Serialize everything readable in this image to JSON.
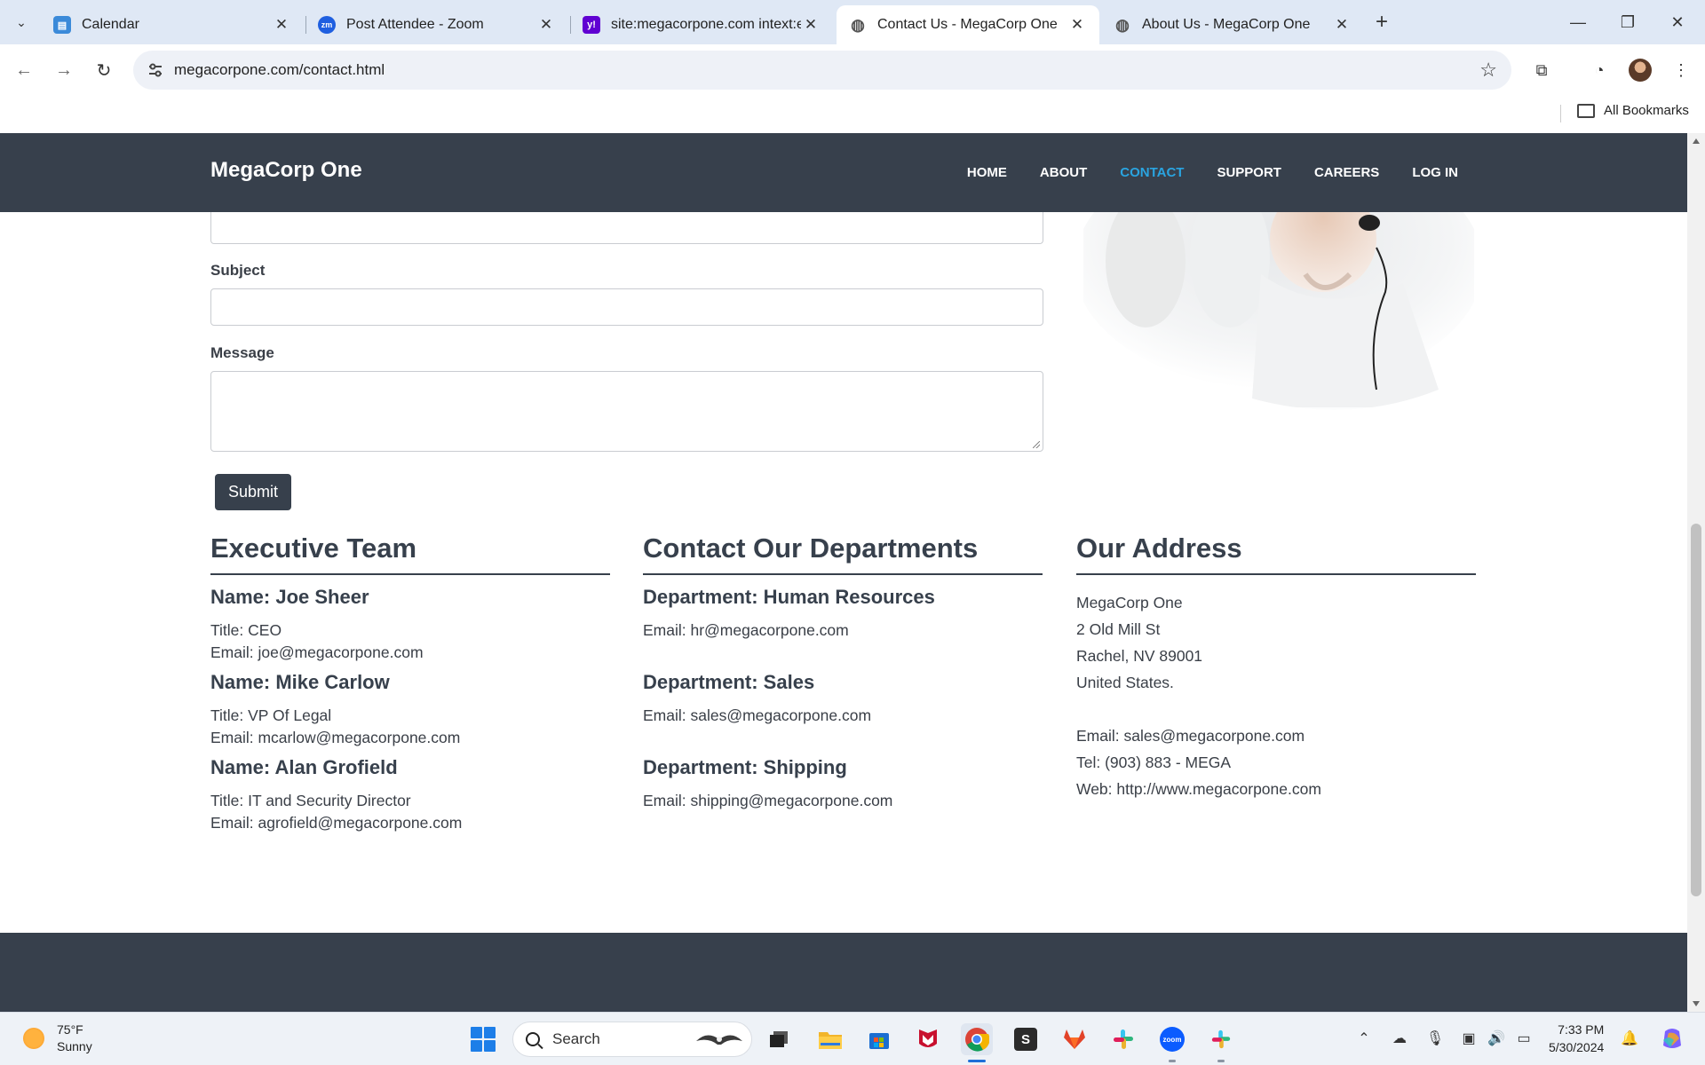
{
  "browser": {
    "tabs": [
      {
        "title": "Calendar",
        "icon": "calendar-favicon",
        "active": false
      },
      {
        "title": "Post Attendee - Zoom",
        "icon": "zoom-favicon",
        "active": false
      },
      {
        "title": "site:megacorpone.com intext:em",
        "icon": "yahoo-favicon",
        "active": false
      },
      {
        "title": "Contact Us - MegaCorp One",
        "icon": "globe-favicon",
        "active": true
      },
      {
        "title": "About Us - MegaCorp One",
        "icon": "globe-favicon",
        "active": false
      }
    ],
    "url": "megacorpone.com/contact.html",
    "bookmarks_label": "All Bookmarks"
  },
  "site": {
    "brand": "MegaCorp One",
    "nav": [
      "HOME",
      "ABOUT",
      "CONTACT",
      "SUPPORT",
      "CAREERS",
      "LOG IN"
    ],
    "current_nav": "CONTACT",
    "colors": {
      "nav_bg": "#37404c",
      "accent": "#2aa4e0"
    }
  },
  "form": {
    "subject_label": "Subject",
    "subject_value": "",
    "message_label": "Message",
    "message_value": "",
    "submit_label": "Submit"
  },
  "executive": {
    "heading": "Executive Team",
    "people": [
      {
        "name": "Name: Joe Sheer",
        "title": "Title: CEO",
        "email": "Email: joe@megacorpone.com"
      },
      {
        "name": "Name: Mike Carlow",
        "title": "Title: VP Of Legal",
        "email": "Email: mcarlow@megacorpone.com"
      },
      {
        "name": "Name: Alan Grofield",
        "title": "Title: IT and Security Director",
        "email": "Email: agrofield@megacorpone.com"
      }
    ]
  },
  "departments": {
    "heading": "Contact Our Departments",
    "items": [
      {
        "name": "Department: Human Resources",
        "email": "Email: hr@megacorpone.com"
      },
      {
        "name": "Department: Sales",
        "email": "Email: sales@megacorpone.com"
      },
      {
        "name": "Department: Shipping",
        "email": "Email: shipping@megacorpone.com"
      }
    ]
  },
  "address": {
    "heading": "Our Address",
    "lines": [
      "MegaCorp One",
      "2 Old Mill St",
      "Rachel, NV 89001",
      "United States."
    ],
    "email": "Email: sales@megacorpone.com",
    "tel": "Tel: (903) 883 - MEGA",
    "web": "Web: http://www.megacorpone.com"
  },
  "taskbar": {
    "weather_temp": "75°F",
    "weather_desc": "Sunny",
    "search_placeholder": "Search",
    "time": "7:33 PM",
    "date": "5/30/2024"
  }
}
